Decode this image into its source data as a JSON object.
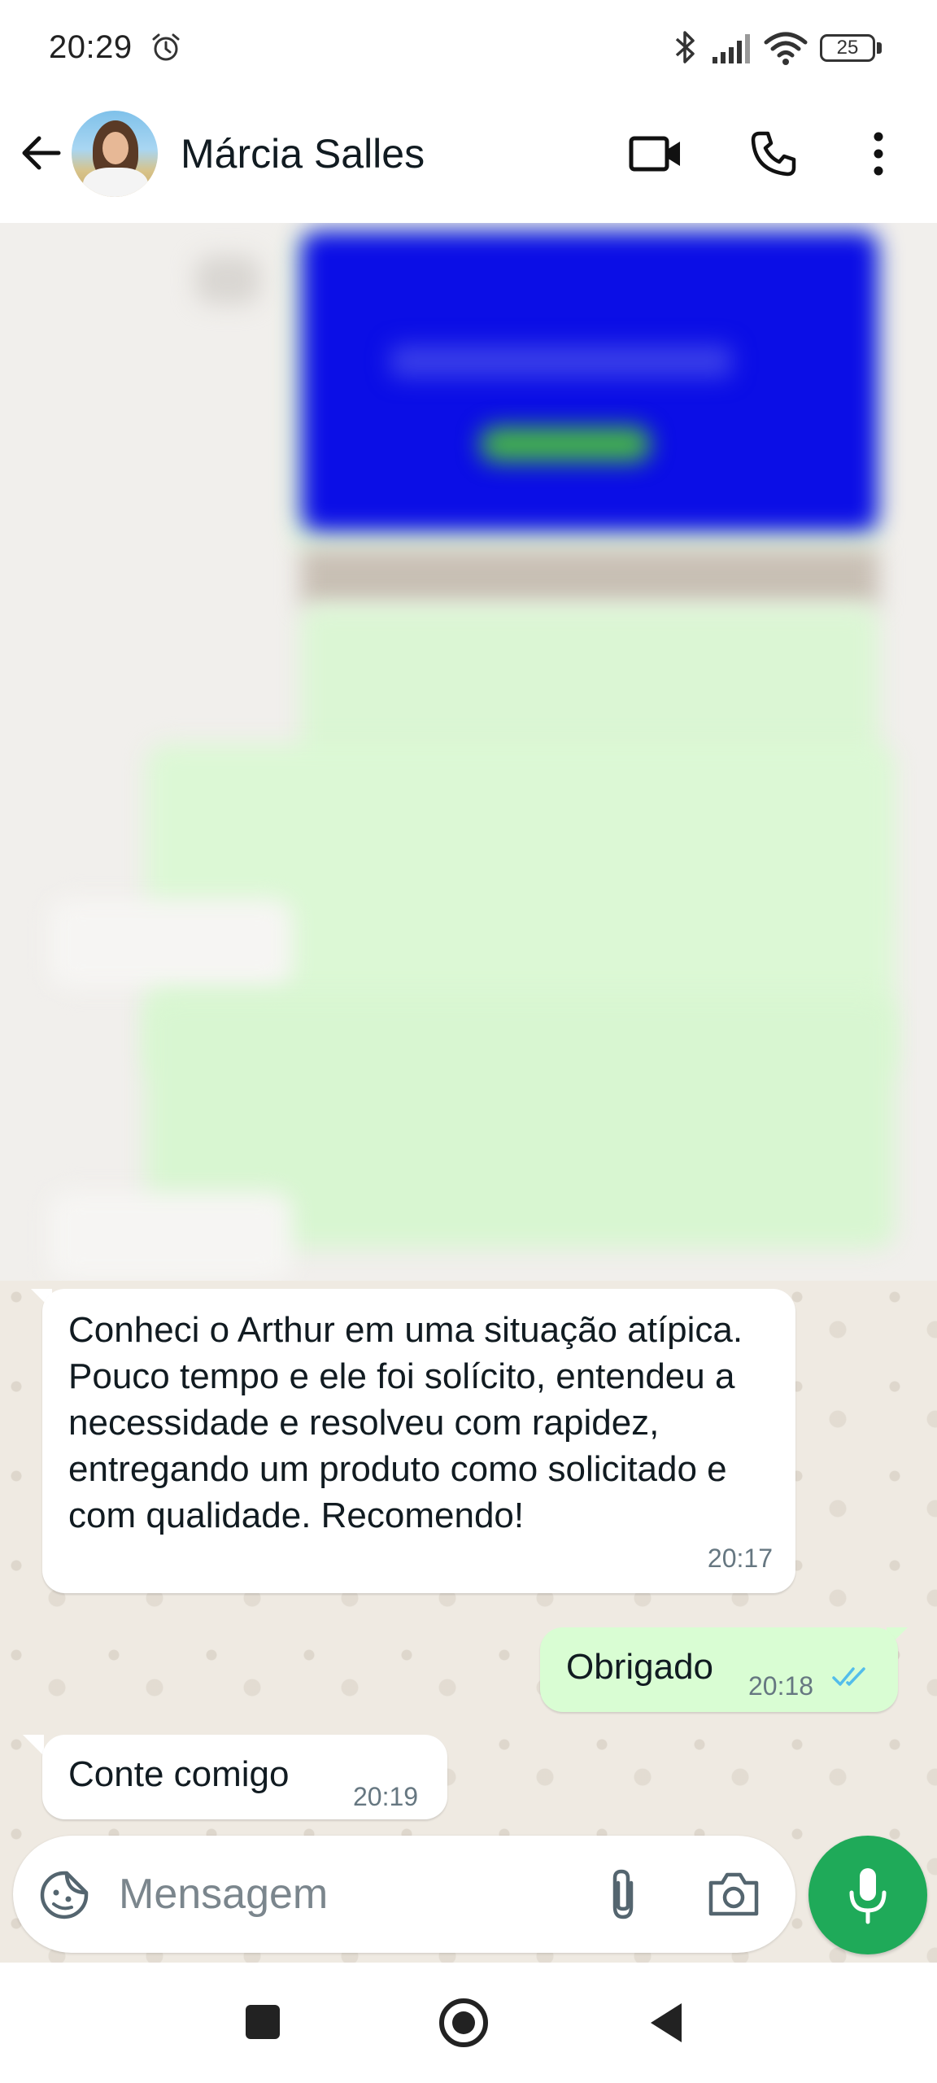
{
  "status_bar": {
    "time": "20:29",
    "battery": "25",
    "icons": [
      "alarm-icon",
      "bluetooth-icon",
      "signal-icon",
      "wifi-icon",
      "battery-icon"
    ]
  },
  "header": {
    "contact_name": "Márcia Salles",
    "actions": [
      "video-call-icon",
      "voice-call-icon",
      "more-options-icon"
    ]
  },
  "messages": [
    {
      "direction": "incoming",
      "text": "Conheci o Arthur em uma situação atípica. Pouco tempo e ele foi solícito, entendeu a necessidade e resolveu com rapidez, entregando um produto como solicitado e com qualidade. Recomendo!",
      "time": "20:17"
    },
    {
      "direction": "outgoing",
      "text": "Obrigado",
      "time": "20:18",
      "status": "read"
    },
    {
      "direction": "incoming",
      "text": "Conte comigo",
      "time": "20:19"
    }
  ],
  "composer": {
    "placeholder": "Mensagem"
  },
  "colors": {
    "outgoing_bubble": "#d9fdd3",
    "incoming_bubble": "#ffffff",
    "accent_green": "#1faa59",
    "read_ticks": "#53bdeb",
    "wallpaper": "#efeae2"
  }
}
